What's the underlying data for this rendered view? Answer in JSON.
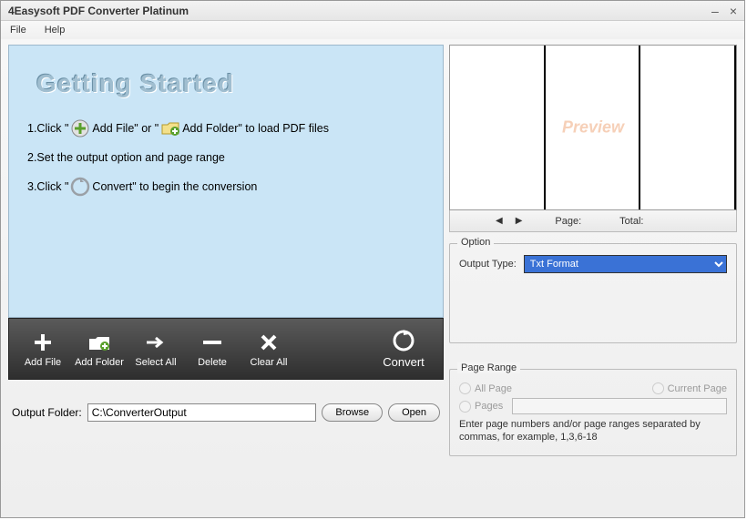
{
  "window": {
    "title": "4Easysoft PDF Converter Platinum"
  },
  "menu": {
    "file": "File",
    "help": "Help"
  },
  "gs": {
    "title": "Getting Started",
    "s1a": "1.Click \" ",
    "s1b": " Add File\" or \" ",
    "s1c": " Add Folder\" to load PDF files",
    "s2": "2.Set the output option and page range",
    "s3a": "3.Click \" ",
    "s3b": " Convert\" to begin the conversion"
  },
  "toolbar": {
    "addfile": "Add File",
    "addfolder": "Add Folder",
    "selectall": "Select All",
    "delete": "Delete",
    "clearall": "Clear All",
    "convert": "Convert"
  },
  "output": {
    "label": "Output Folder:",
    "path": "C:\\ConverterOutput",
    "browse": "Browse",
    "open": "Open"
  },
  "preview": {
    "text": "Preview"
  },
  "pager": {
    "page": "Page:",
    "total": "Total:"
  },
  "option": {
    "legend": "Option",
    "outputtype_lbl": "Output Type:",
    "outputtype_val": "Txt Format"
  },
  "pagerange": {
    "legend": "Page Range",
    "all": "All Page",
    "current": "Current Page",
    "pages": "Pages",
    "hint": "Enter page numbers and/or page ranges separated by commas, for example, 1,3,6-18"
  }
}
